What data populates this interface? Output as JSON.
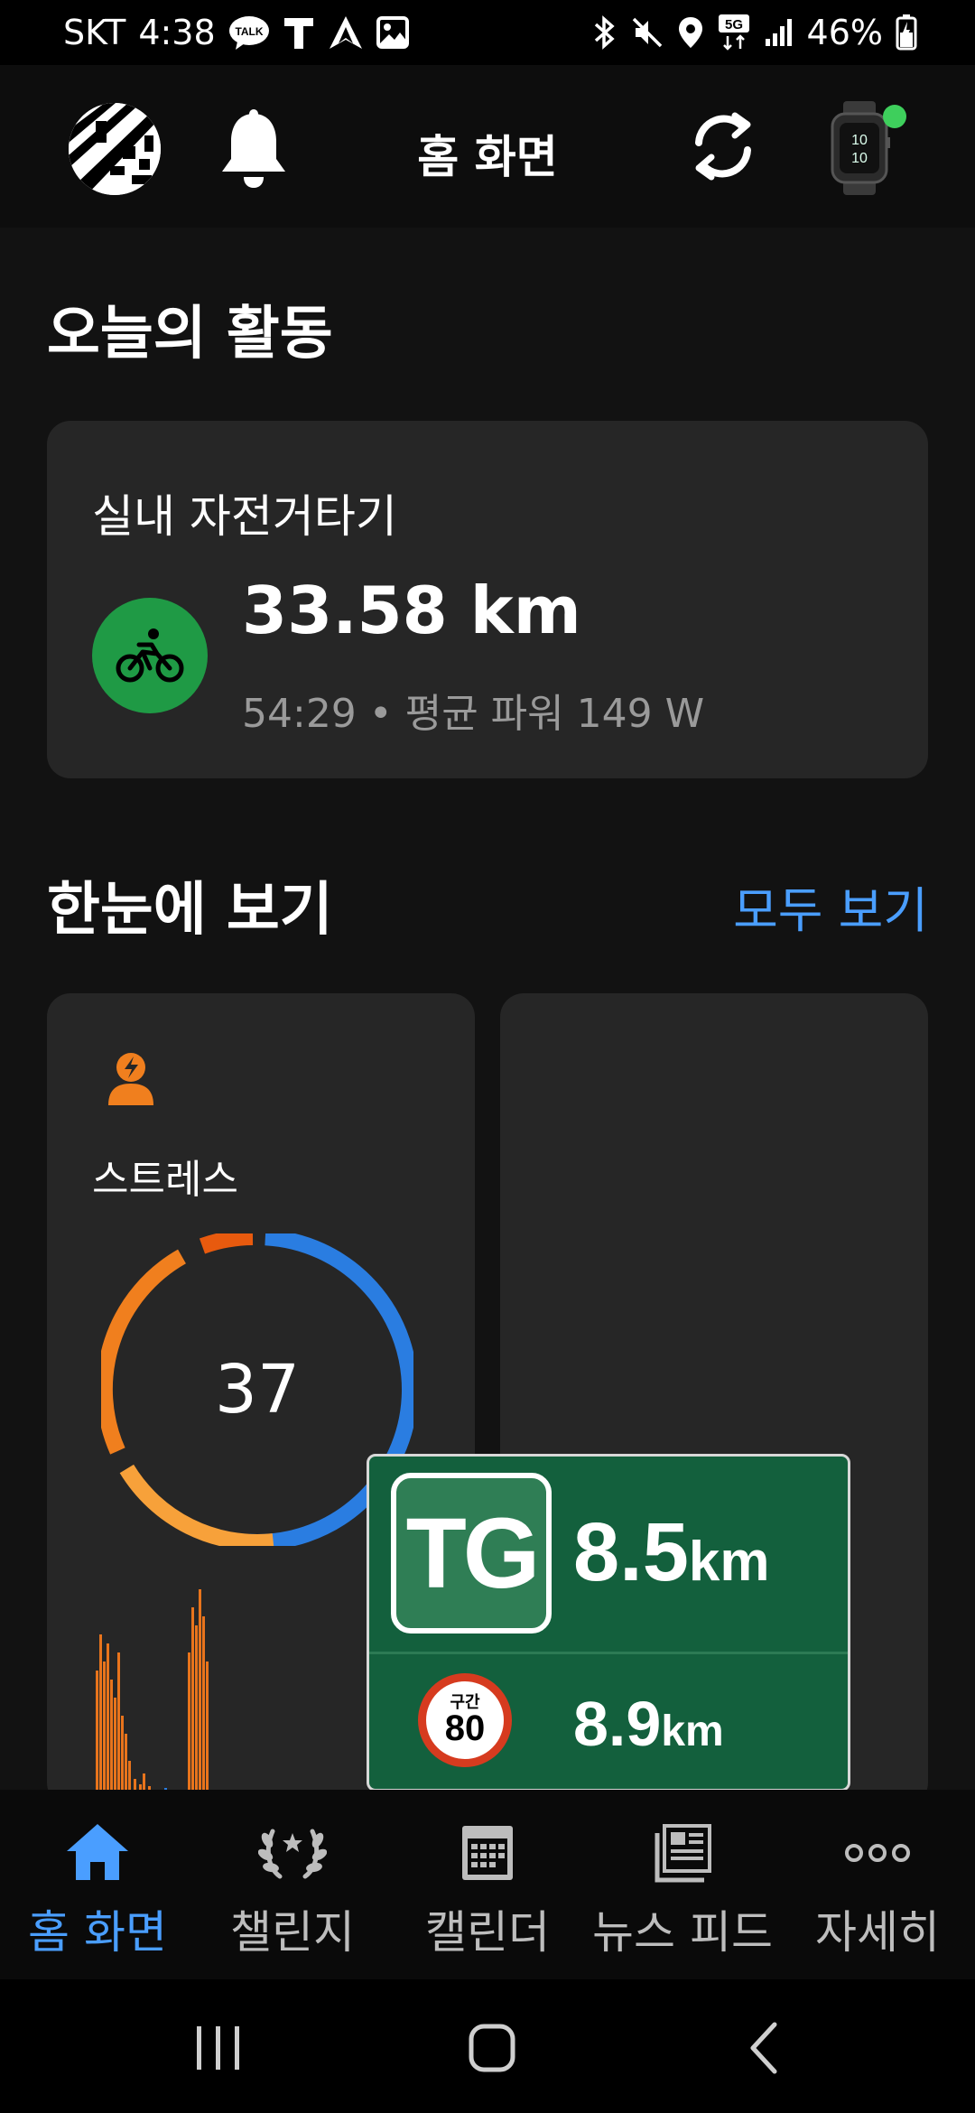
{
  "status_bar": {
    "carrier": "SKT",
    "time": "4:38",
    "talk_badge": "TALK",
    "network": "5G",
    "battery": "46%"
  },
  "app_bar": {
    "title": "홈 화면"
  },
  "today": {
    "heading": "오늘의 활동",
    "activity": {
      "name": "실내 자전거타기",
      "distance": "33.58 km",
      "details": "54:29 • 평균 파워 149 W"
    }
  },
  "glance": {
    "heading": "한눈에 보기",
    "see_all": "모두 보기",
    "stress": {
      "label": "스트레스",
      "value": "37"
    }
  },
  "navi_overlay": {
    "tg_label": "TG",
    "tg_distance": "8.5",
    "tg_unit": "km",
    "speed_zone_label": "구간",
    "speed_limit": "80",
    "zone_distance": "8.9",
    "zone_unit": "km"
  },
  "bottom_nav": {
    "items": [
      {
        "label": "홈 화면",
        "icon": "home-icon",
        "active": true
      },
      {
        "label": "챌린지",
        "icon": "laurel-icon"
      },
      {
        "label": "캘린더",
        "icon": "calendar-icon"
      },
      {
        "label": "뉴스 피드",
        "icon": "newsfeed-icon"
      },
      {
        "label": "자세히",
        "icon": "more-icon"
      }
    ]
  },
  "colors": {
    "accent": "#4a9eff",
    "activity_green": "#1f9a45",
    "stress_orange": "#f07f1e",
    "stress_blue": "#2a7de1",
    "navi_green": "#13603d",
    "background": "#121212",
    "card": "#262626"
  }
}
